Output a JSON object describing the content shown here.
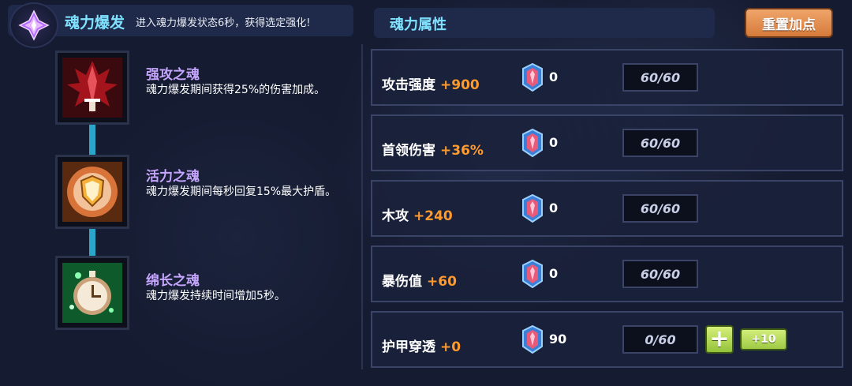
{
  "soul_burst": {
    "title": "魂力爆发",
    "description": "进入魂力爆发状态6秒，获得选定强化!",
    "icon": "purple-crystal-icon"
  },
  "souls": [
    {
      "name": "强攻之魂",
      "description": "魂力爆发期间获得25%的伤害加成。",
      "icon": "red-sword-soul-icon"
    },
    {
      "name": "活力之魂",
      "description": "魂力爆发期间每秒回复15%最大护盾。",
      "icon": "orange-shield-soul-icon"
    },
    {
      "name": "绵长之魂",
      "description": "魂力爆发持续时间增加5秒。",
      "icon": "green-stopwatch-soul-icon"
    }
  ],
  "attributes": {
    "title": "魂力属性",
    "reset_label": "重置加点",
    "rows": [
      {
        "name": "攻击强度",
        "bonus": "+900",
        "gem_count": "0",
        "progress": "60/60"
      },
      {
        "name": "首领伤害",
        "bonus": "+36%",
        "gem_count": "0",
        "progress": "60/60"
      },
      {
        "name": "木攻",
        "bonus": "+240",
        "gem_count": "0",
        "progress": "60/60"
      },
      {
        "name": "暴伤值",
        "bonus": "+60",
        "gem_count": "0",
        "progress": "60/60"
      },
      {
        "name": "护甲穿透",
        "bonus": "+0",
        "gem_count": "90",
        "progress": "0/60"
      }
    ],
    "plus_label": "+",
    "plus10_label": "+10"
  },
  "colors": {
    "accent_cyan": "#7fe3ff",
    "soul_name_purple": "#c6a6ff",
    "bonus_orange": "#ff9a2e",
    "reset_orange": "#e08c4e",
    "plus_green": "#a8d24a"
  }
}
